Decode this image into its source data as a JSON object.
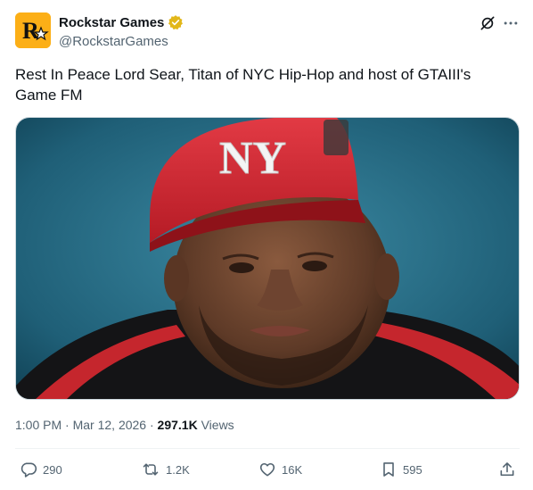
{
  "author": {
    "display_name": "Rockstar Games",
    "handle": "@RockstarGames",
    "logo_text": "R",
    "verified_color": "#e2b719"
  },
  "tweet": {
    "text": "Rest In Peace Lord Sear, Titan of NYC Hip-Hop and host of GTAIII's Game FM",
    "time": "1:00 PM",
    "date": "Mar 12, 2026",
    "views_count": "297.1K",
    "views_label": "Views"
  },
  "media": {
    "cap_logo_text": "NY",
    "cap_color": "#d8232f"
  },
  "actions": {
    "replies": "290",
    "reposts": "1.2K",
    "likes": "16K",
    "bookmarks": "595"
  },
  "icons": {
    "header": [
      "grok-icon",
      "more-icon"
    ],
    "actions": [
      "reply-icon",
      "repost-icon",
      "like-icon",
      "bookmark-icon",
      "share-icon"
    ]
  },
  "colors": {
    "text_primary": "#0f1419",
    "text_secondary": "#536471",
    "brand": "#fcaf17"
  }
}
